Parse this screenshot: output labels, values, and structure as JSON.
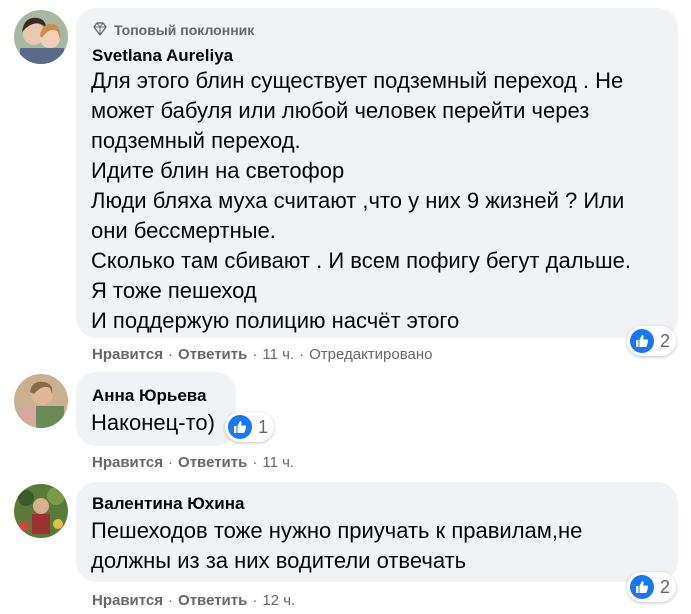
{
  "colors": {
    "bubble": "#f0f2f5",
    "meta": "#65676b",
    "like_blue": "#1877f2",
    "text": "#050505"
  },
  "comments": [
    {
      "badge": "Топовый поклонник",
      "badge_icon": "diamond-icon",
      "author": "Svetlana Aureliya",
      "lines": [
        "Для этого блин существует подземный переход . Не",
        "может бабуля или любой человек перейти через",
        "подземный переход.",
        "Идите блин на светофор",
        "Люди бляха муха считают ,что у них 9 жизней ? Или",
        "они бессмертные.",
        "Сколько там сбивают . И всем пофигу бегут дальше.",
        "Я тоже пешеход",
        "И поддержую полицию насчёт этого"
      ],
      "like_label": "Нравится",
      "reply_label": "Ответить",
      "time": "11 ч.",
      "edited": "Отредактировано",
      "reaction_count": "2"
    },
    {
      "author": "Анна Юрьева",
      "lines": [
        "Наконец-то)"
      ],
      "like_label": "Нравится",
      "reply_label": "Ответить",
      "time": "11 ч.",
      "reaction_count": "1"
    },
    {
      "author": "Валентина Юхина",
      "lines": [
        "Пешеходов тоже нужно приучать к правилам,не",
        "должны из за них водители отвечать"
      ],
      "like_label": "Нравится",
      "reply_label": "Ответить",
      "time": "12 ч.",
      "reaction_count": "2"
    }
  ]
}
